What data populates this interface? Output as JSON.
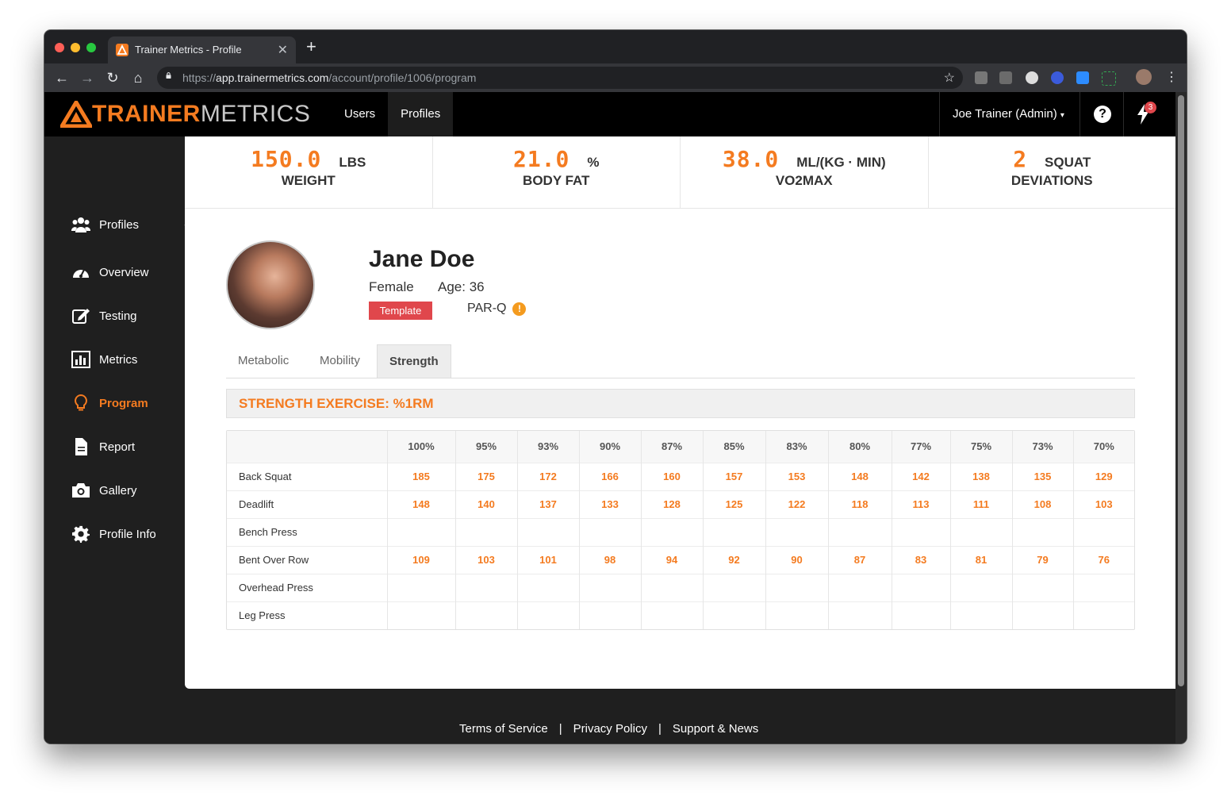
{
  "browser": {
    "tab_title": "Trainer Metrics - Profile",
    "url_scheme": "https://",
    "url_host": "app.trainermetrics.com",
    "url_path": "/account/profile/1006/program"
  },
  "header": {
    "logo_part1": "TRAINER",
    "logo_part2": "METRICS",
    "nav": [
      {
        "label": "Users"
      },
      {
        "label": "Profiles"
      }
    ],
    "user_menu": "Joe Trainer (Admin)",
    "notification_count": "3"
  },
  "sidebar": {
    "items": [
      {
        "label": "Profiles",
        "icon": "users-icon"
      },
      {
        "label": "Overview",
        "icon": "dashboard-icon"
      },
      {
        "label": "Testing",
        "icon": "edit-icon"
      },
      {
        "label": "Metrics",
        "icon": "bar-chart-icon"
      },
      {
        "label": "Program",
        "icon": "lightbulb-icon"
      },
      {
        "label": "Report",
        "icon": "document-icon"
      },
      {
        "label": "Gallery",
        "icon": "camera-icon"
      },
      {
        "label": "Profile Info",
        "icon": "gear-icon"
      }
    ]
  },
  "stats": [
    {
      "value": "150.0",
      "unit": "LBS",
      "label": "WEIGHT"
    },
    {
      "value": "21.0",
      "unit": "%",
      "label": "BODY FAT"
    },
    {
      "value": "38.0",
      "unit": "ML/(KG · MIN)",
      "label": "VO2MAX"
    },
    {
      "value": "2",
      "unit": "SQUAT",
      "label": "DEVIATIONS"
    }
  ],
  "profile": {
    "name": "Jane Doe",
    "gender": "Female",
    "age": "Age: 36",
    "badge": "Template",
    "parq": "PAR-Q"
  },
  "tabs": [
    {
      "label": "Metabolic"
    },
    {
      "label": "Mobility"
    },
    {
      "label": "Strength"
    }
  ],
  "section_title": "STRENGTH EXERCISE: %1RM",
  "table": {
    "headers": [
      "100%",
      "95%",
      "93%",
      "90%",
      "87%",
      "85%",
      "83%",
      "80%",
      "77%",
      "75%",
      "73%",
      "70%"
    ],
    "rows": [
      {
        "exercise": "Back Squat",
        "values": [
          "185",
          "175",
          "172",
          "166",
          "160",
          "157",
          "153",
          "148",
          "142",
          "138",
          "135",
          "129"
        ]
      },
      {
        "exercise": "Deadlift",
        "values": [
          "148",
          "140",
          "137",
          "133",
          "128",
          "125",
          "122",
          "118",
          "113",
          "111",
          "108",
          "103"
        ]
      },
      {
        "exercise": "Bench Press",
        "values": [
          "",
          "",
          "",
          "",
          "",
          "",
          "",
          "",
          "",
          "",
          "",
          ""
        ]
      },
      {
        "exercise": "Bent Over Row",
        "values": [
          "109",
          "103",
          "101",
          "98",
          "94",
          "92",
          "90",
          "87",
          "83",
          "81",
          "79",
          "76"
        ]
      },
      {
        "exercise": "Overhead Press",
        "values": [
          "",
          "",
          "",
          "",
          "",
          "",
          "",
          "",
          "",
          "",
          "",
          ""
        ]
      },
      {
        "exercise": "Leg Press",
        "values": [
          "",
          "",
          "",
          "",
          "",
          "",
          "",
          "",
          "",
          "",
          "",
          ""
        ]
      }
    ]
  },
  "footer": {
    "links": [
      "Terms of Service",
      "Privacy Policy",
      "Support & News"
    ],
    "separator": "|"
  },
  "colors": {
    "accent": "#f47b20",
    "badge_red": "#e0474c",
    "sidebar_bg": "#1f1f1f"
  }
}
